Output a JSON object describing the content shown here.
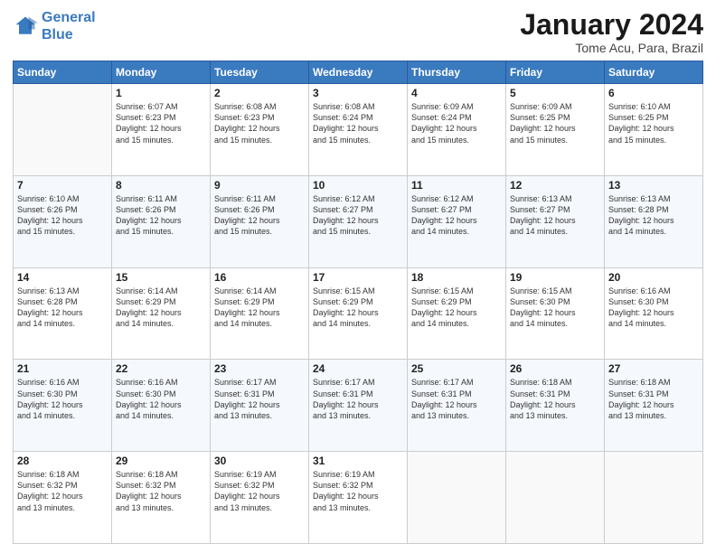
{
  "logo": {
    "line1": "General",
    "line2": "Blue"
  },
  "title": "January 2024",
  "subtitle": "Tome Acu, Para, Brazil",
  "days_header": [
    "Sunday",
    "Monday",
    "Tuesday",
    "Wednesday",
    "Thursday",
    "Friday",
    "Saturday"
  ],
  "weeks": [
    [
      {
        "num": "",
        "info": ""
      },
      {
        "num": "1",
        "info": "Sunrise: 6:07 AM\nSunset: 6:23 PM\nDaylight: 12 hours\nand 15 minutes."
      },
      {
        "num": "2",
        "info": "Sunrise: 6:08 AM\nSunset: 6:23 PM\nDaylight: 12 hours\nand 15 minutes."
      },
      {
        "num": "3",
        "info": "Sunrise: 6:08 AM\nSunset: 6:24 PM\nDaylight: 12 hours\nand 15 minutes."
      },
      {
        "num": "4",
        "info": "Sunrise: 6:09 AM\nSunset: 6:24 PM\nDaylight: 12 hours\nand 15 minutes."
      },
      {
        "num": "5",
        "info": "Sunrise: 6:09 AM\nSunset: 6:25 PM\nDaylight: 12 hours\nand 15 minutes."
      },
      {
        "num": "6",
        "info": "Sunrise: 6:10 AM\nSunset: 6:25 PM\nDaylight: 12 hours\nand 15 minutes."
      }
    ],
    [
      {
        "num": "7",
        "info": "Sunrise: 6:10 AM\nSunset: 6:26 PM\nDaylight: 12 hours\nand 15 minutes."
      },
      {
        "num": "8",
        "info": "Sunrise: 6:11 AM\nSunset: 6:26 PM\nDaylight: 12 hours\nand 15 minutes."
      },
      {
        "num": "9",
        "info": "Sunrise: 6:11 AM\nSunset: 6:26 PM\nDaylight: 12 hours\nand 15 minutes."
      },
      {
        "num": "10",
        "info": "Sunrise: 6:12 AM\nSunset: 6:27 PM\nDaylight: 12 hours\nand 15 minutes."
      },
      {
        "num": "11",
        "info": "Sunrise: 6:12 AM\nSunset: 6:27 PM\nDaylight: 12 hours\nand 14 minutes."
      },
      {
        "num": "12",
        "info": "Sunrise: 6:13 AM\nSunset: 6:27 PM\nDaylight: 12 hours\nand 14 minutes."
      },
      {
        "num": "13",
        "info": "Sunrise: 6:13 AM\nSunset: 6:28 PM\nDaylight: 12 hours\nand 14 minutes."
      }
    ],
    [
      {
        "num": "14",
        "info": "Sunrise: 6:13 AM\nSunset: 6:28 PM\nDaylight: 12 hours\nand 14 minutes."
      },
      {
        "num": "15",
        "info": "Sunrise: 6:14 AM\nSunset: 6:29 PM\nDaylight: 12 hours\nand 14 minutes."
      },
      {
        "num": "16",
        "info": "Sunrise: 6:14 AM\nSunset: 6:29 PM\nDaylight: 12 hours\nand 14 minutes."
      },
      {
        "num": "17",
        "info": "Sunrise: 6:15 AM\nSunset: 6:29 PM\nDaylight: 12 hours\nand 14 minutes."
      },
      {
        "num": "18",
        "info": "Sunrise: 6:15 AM\nSunset: 6:29 PM\nDaylight: 12 hours\nand 14 minutes."
      },
      {
        "num": "19",
        "info": "Sunrise: 6:15 AM\nSunset: 6:30 PM\nDaylight: 12 hours\nand 14 minutes."
      },
      {
        "num": "20",
        "info": "Sunrise: 6:16 AM\nSunset: 6:30 PM\nDaylight: 12 hours\nand 14 minutes."
      }
    ],
    [
      {
        "num": "21",
        "info": "Sunrise: 6:16 AM\nSunset: 6:30 PM\nDaylight: 12 hours\nand 14 minutes."
      },
      {
        "num": "22",
        "info": "Sunrise: 6:16 AM\nSunset: 6:30 PM\nDaylight: 12 hours\nand 14 minutes."
      },
      {
        "num": "23",
        "info": "Sunrise: 6:17 AM\nSunset: 6:31 PM\nDaylight: 12 hours\nand 13 minutes."
      },
      {
        "num": "24",
        "info": "Sunrise: 6:17 AM\nSunset: 6:31 PM\nDaylight: 12 hours\nand 13 minutes."
      },
      {
        "num": "25",
        "info": "Sunrise: 6:17 AM\nSunset: 6:31 PM\nDaylight: 12 hours\nand 13 minutes."
      },
      {
        "num": "26",
        "info": "Sunrise: 6:18 AM\nSunset: 6:31 PM\nDaylight: 12 hours\nand 13 minutes."
      },
      {
        "num": "27",
        "info": "Sunrise: 6:18 AM\nSunset: 6:31 PM\nDaylight: 12 hours\nand 13 minutes."
      }
    ],
    [
      {
        "num": "28",
        "info": "Sunrise: 6:18 AM\nSunset: 6:32 PM\nDaylight: 12 hours\nand 13 minutes."
      },
      {
        "num": "29",
        "info": "Sunrise: 6:18 AM\nSunset: 6:32 PM\nDaylight: 12 hours\nand 13 minutes."
      },
      {
        "num": "30",
        "info": "Sunrise: 6:19 AM\nSunset: 6:32 PM\nDaylight: 12 hours\nand 13 minutes."
      },
      {
        "num": "31",
        "info": "Sunrise: 6:19 AM\nSunset: 6:32 PM\nDaylight: 12 hours\nand 13 minutes."
      },
      {
        "num": "",
        "info": ""
      },
      {
        "num": "",
        "info": ""
      },
      {
        "num": "",
        "info": ""
      }
    ]
  ]
}
